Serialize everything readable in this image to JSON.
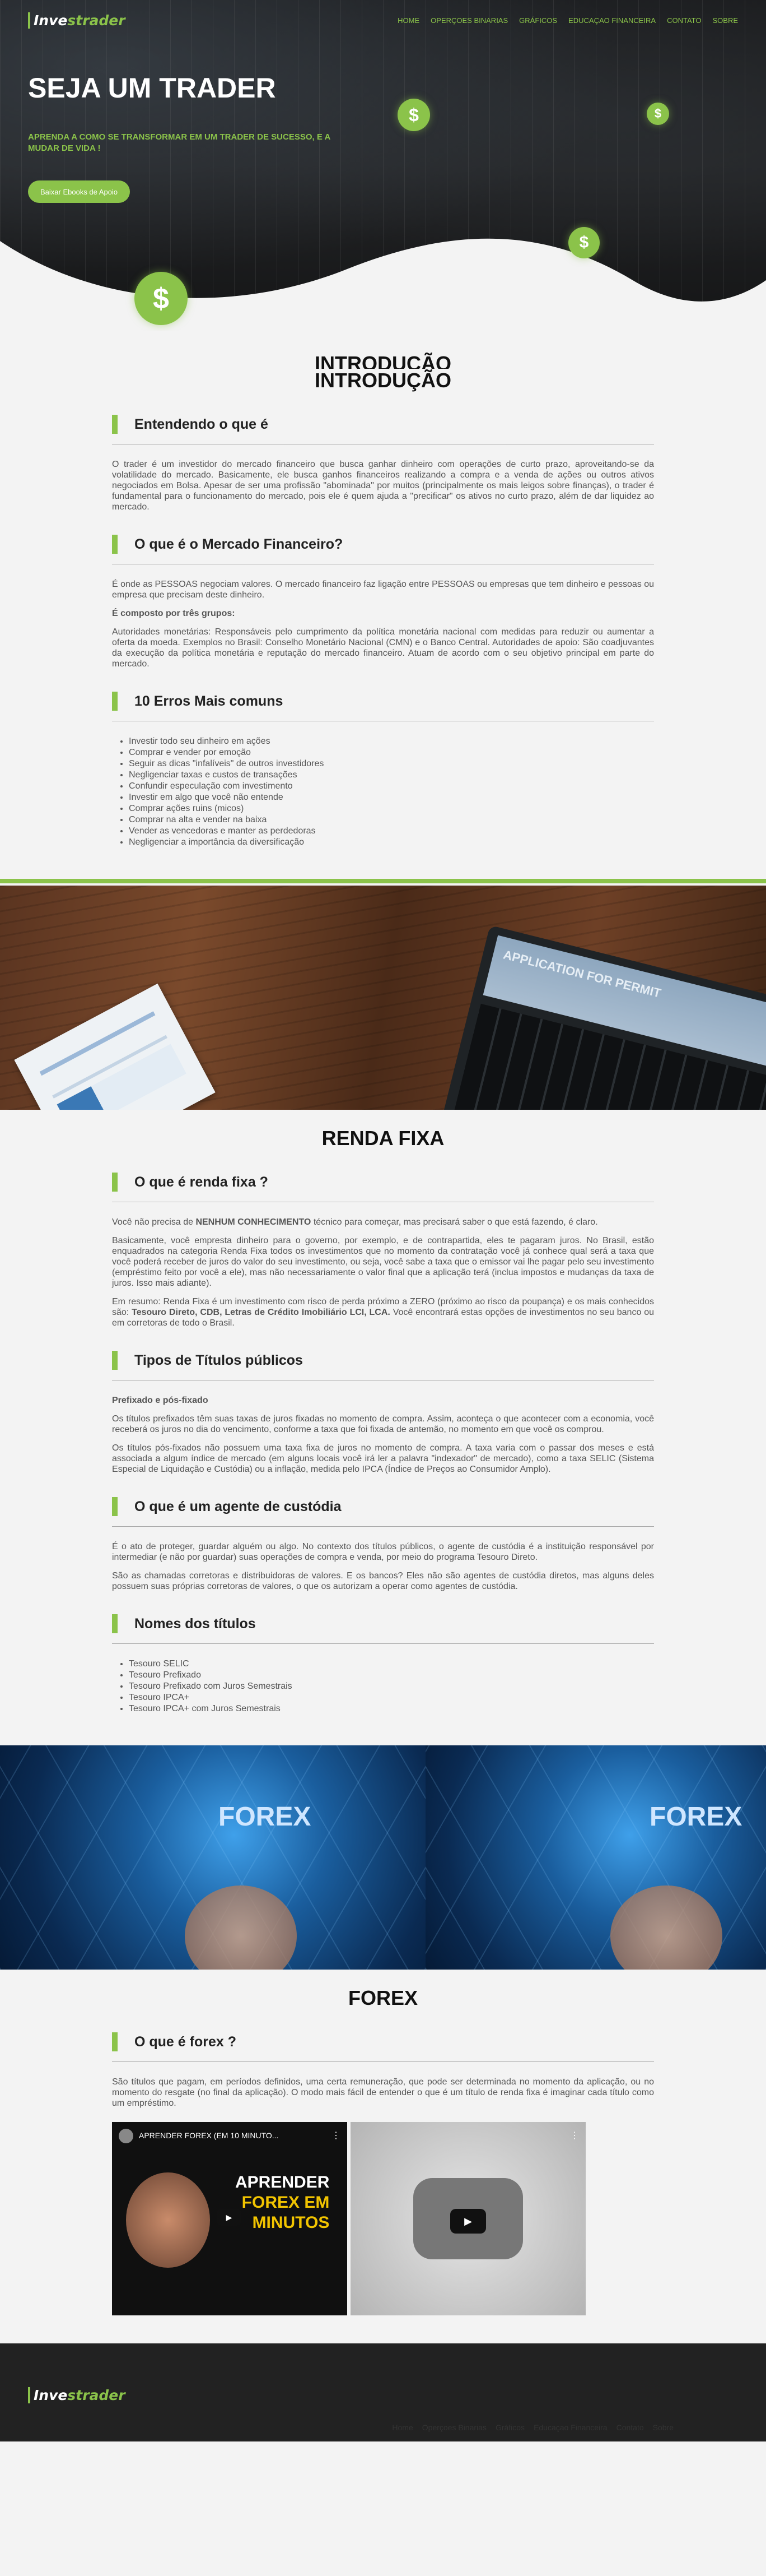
{
  "nav": {
    "logo_left": "Inve",
    "logo_right": "strader",
    "items": [
      "HOME",
      "OPERÇOES BINARIAS",
      "GRÁFICOS",
      "EDUCAÇAO FINANCEIRA",
      "CONTATO",
      "SOBRE"
    ]
  },
  "hero": {
    "title": "SEJA UM TRADER",
    "subtitle": "APRENDA A COMO SE TRANSFORMAR EM UM TRADER DE SUCESSO, E A MUDAR DE VIDA !",
    "button": "Baixar Ebooks de Apoio",
    "coin_symbol": "$"
  },
  "intro": {
    "ghost_title": "INTRODUÇÃO",
    "title": "INTRODUÇÃO",
    "entendendo": {
      "heading": "Entendendo o que é",
      "text": "O trader é um investidor do mercado financeiro que busca ganhar dinheiro com operações de curto prazo, aproveitando-se da volatilidade do mercado. Basicamente, ele busca ganhos financeiros realizando a compra e a venda de ações ou outros ativos negociados em Bolsa. Apesar de ser uma profissão \"abominada\" por muitos (principalmente os mais leigos sobre finanças), o trader é fundamental para o funcionamento do mercado, pois ele é quem ajuda a \"precificar\" os ativos no curto prazo, além de dar liquidez ao mercado."
    },
    "mercado": {
      "heading": "O que é o Mercado Financeiro?",
      "text": "É onde as PESSOAS negociam valores. O mercado financeiro faz ligação entre PESSOAS ou empresas que tem dinheiro e pessoas ou empresa que precisam deste dinheiro.",
      "grupos_title": "É composto por três grupos:",
      "grupos_text": "Autoridades monetárias: Responsáveis pelo cumprimento da política monetária nacional com medidas para reduzir ou aumentar a oferta da moeda. Exemplos no Brasil: Conselho Monetário Nacional (CMN) e o Banco Central. Autoridades de apoio: São coadjuvantes da execução da política monetária e reputação do mercado financeiro. Atuam de acordo com o seu objetivo principal em parte do mercado."
    },
    "erros": {
      "heading": "10 Erros Mais comuns",
      "items": [
        "Investir todo seu dinheiro em ações",
        "Comprar e vender por emoção",
        "Seguir as dicas \"infalíveis\" de outros investidores",
        "Negligenciar taxas e custos de transações",
        "Confundir especulação com investimento",
        "Investir em algo que você não entende",
        "Comprar ações ruins (micos)",
        "Comprar na alta e vender na baixa",
        "Vender as vencedoras e manter as perdedoras",
        "Negligenciar a importância da diversificação"
      ]
    }
  },
  "renda": {
    "title": "RENDA FIXA",
    "oque": {
      "heading": "O que é renda fixa ?",
      "p1_pre": "Você não precisa de ",
      "p1_bold": "NENHUM CONHECIMENTO",
      "p1_post": " técnico para começar, mas precisará saber o que está fazendo, é claro.",
      "p2": "Basicamente, você empresta dinheiro para o governo, por exemplo, e de contrapartida, eles te pagaram juros. No Brasil, estão enquadrados na categoria Renda Fixa todos os investimentos que no momento da contratação você já conhece qual será a taxa que você poderá receber de juros do valor do seu investimento, ou seja, você sabe a taxa que o emissor vai lhe pagar pelo seu investimento (empréstimo feito por você a ele), mas não necessariamente o valor final que a aplicação terá (inclua impostos e mudanças da taxa de juros. Isso mais adiante).",
      "p3_pre": "Em resumo: Renda Fixa é um investimento com risco de perda próximo a ZERO (próximo ao risco da poupança) e os mais conhecidos são: ",
      "p3_bold": "Tesouro Direto, CDB, Letras de Crédito Imobiliário LCI, LCA.",
      "p3_post": " Você encontrará estas opções de investimentos no seu banco ou em corretoras de todo o Brasil."
    },
    "tipos": {
      "heading": "Tipos de Títulos públicos",
      "sub": "Prefixado e pós-fixado",
      "p1": "Os títulos prefixados têm suas taxas de juros fixadas no momento de compra. Assim, aconteça o que acontecer com a economia, você receberá os juros no dia do vencimento, conforme a taxa que foi fixada de antemão, no momento em que você os comprou.",
      "p2": "Os títulos pós-fixados não possuem uma taxa fixa de juros no momento de compra. A taxa varia com o passar dos meses e está associada a algum índice de mercado (em alguns locais você irá ler a palavra \"indexador\" de mercado), como a taxa SELIC (Sistema Especial de Liquidação e Custódia) ou a inflação, medida pelo IPCA (Índice de Preços ao Consumidor Amplo)."
    },
    "agente": {
      "heading": "O que é um agente de custódia",
      "p1": "É o ato de proteger, guardar alguém ou algo. No contexto dos títulos públicos, o agente de custódia é a instituição responsável por intermediar (e não por guardar) suas operações de compra e venda, por meio do programa Tesouro Direto.",
      "p2": "São as chamadas corretoras e distribuidoras de valores. E os bancos? Eles não são agentes de custódia diretos, mas alguns deles possuem suas próprias corretoras de valores, o que os autorizam a operar como agentes de custódia."
    },
    "nomes": {
      "heading": "Nomes dos títulos",
      "items": [
        "Tesouro SELIC",
        "Tesouro Prefixado",
        "Tesouro Prefixado com Juros Semestrais",
        "Tesouro IPCA+",
        "Tesouro IPCA+ com Juros Semestrais"
      ]
    }
  },
  "forex_banner": {
    "label": "FOREX"
  },
  "laptop_banner": {
    "screen_text": "APPLICATION FOR PERMIT"
  },
  "forex": {
    "title": "FOREX",
    "heading": "O que é forex ?",
    "text": "São títulos que pagam, em períodos definidos, uma certa remuneração, que pode ser determinada no momento da aplicação, ou no momento do resgate (no final da aplicação). O modo mais fácil de entender o que é um título de renda fixa é imaginar cada título como um empréstimo.",
    "video1_title": "APRENDER FOREX (EM 10 MINUTO...",
    "video1_thumb_lines": [
      "APRENDER",
      "FOREX EM",
      "MINUTOS"
    ]
  },
  "footer": {
    "logo_left": "Inve",
    "logo_right": "strader",
    "items": [
      "Home",
      "Operçoes Binarias",
      "Gráficos",
      "Educaçao Financeira",
      "Contato",
      "Sobre"
    ]
  },
  "colors": {
    "accent": "#8bc34a",
    "dark": "#151618",
    "background": "#f3f3f3"
  }
}
